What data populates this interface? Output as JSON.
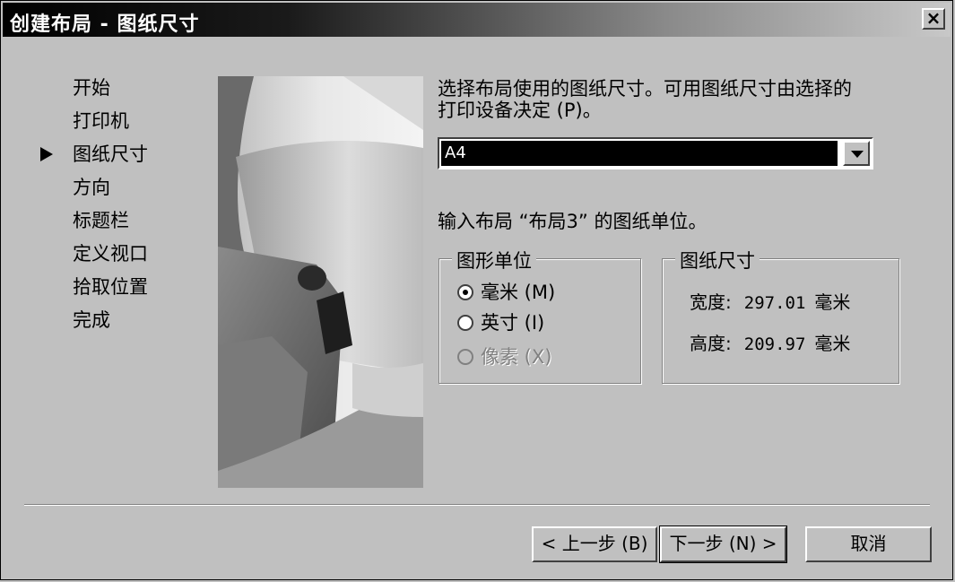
{
  "window": {
    "title": "创建布局 - 图纸尺寸",
    "close_label": "×"
  },
  "steps": [
    "开始",
    "打印机",
    "图纸尺寸",
    "方向",
    "标题栏",
    "定义视口",
    "拾取位置",
    "完成"
  ],
  "current_step": "图纸尺寸",
  "description": {
    "line1": "选择布局使用的图纸尺寸。可用图纸尺寸由选择的",
    "line2": "打印设备决定 (P)。"
  },
  "paper_size": {
    "value": "A4"
  },
  "unit_label": "输入布局 “布局3” 的图纸单位。",
  "units_group": {
    "title": "图形单位",
    "options": [
      {
        "label": "毫米 (M)",
        "selected": true,
        "enabled": true
      },
      {
        "label": "英寸 (I)",
        "selected": false,
        "enabled": true
      },
      {
        "label": "像素 (X)",
        "selected": false,
        "enabled": false
      }
    ]
  },
  "paper_group": {
    "title": "图纸尺寸",
    "width_label": "宽度:",
    "width_value": "297.01",
    "width_unit": "毫米",
    "height_label": "高度:",
    "height_value": "209.97",
    "height_unit": "毫米"
  },
  "buttons": {
    "back": "< 上一步 (B)",
    "next": "下一步 (N) >",
    "cancel": "取消"
  }
}
